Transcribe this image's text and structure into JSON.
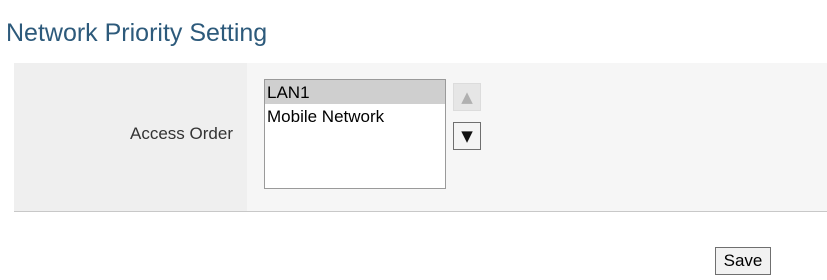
{
  "section": {
    "title": "Network Priority Setting"
  },
  "access_order": {
    "label": "Access Order",
    "options": [
      {
        "label": "LAN1",
        "selected": true
      },
      {
        "label": "Mobile Network",
        "selected": false
      }
    ],
    "move_up_glyph": "▲",
    "move_down_glyph": "▼",
    "move_up_enabled": false,
    "move_down_enabled": true
  },
  "actions": {
    "save_label": "Save"
  },
  "colors": {
    "title": "#2d5a7b",
    "label_bg": "#efefef",
    "value_bg": "#f6f6f6",
    "selected_option_bg": "#cfcfcf"
  }
}
